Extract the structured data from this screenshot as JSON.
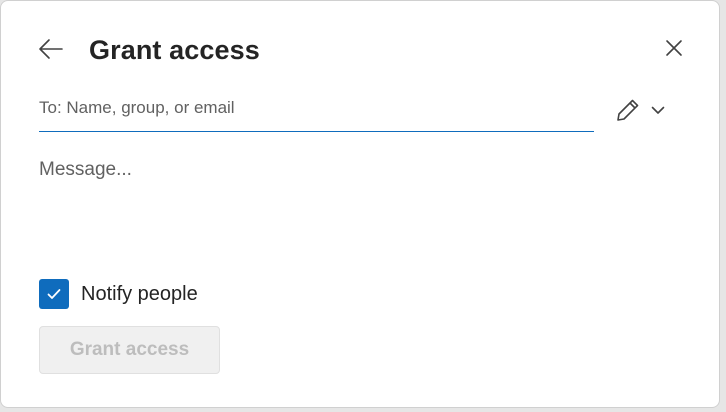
{
  "dialog": {
    "title": "Grant access",
    "to_field": {
      "placeholder": "To: Name, group, or email",
      "value": ""
    },
    "message": {
      "placeholder": "Message...",
      "value": ""
    },
    "notify": {
      "label": "Notify people",
      "checked": true
    },
    "grant_button": {
      "label": "Grant access",
      "enabled": false
    },
    "icons": {
      "back": "back-arrow-icon",
      "close": "close-icon",
      "permission": "pencil-icon",
      "permission_dropdown": "chevron-down-icon",
      "notify_check": "checkmark-icon"
    },
    "colors": {
      "accent": "#0f6cbd",
      "title_text": "#242424",
      "placeholder_text": "#616161",
      "disabled_button_bg": "#f0f0f0",
      "disabled_button_text": "#bdbdbd"
    }
  }
}
